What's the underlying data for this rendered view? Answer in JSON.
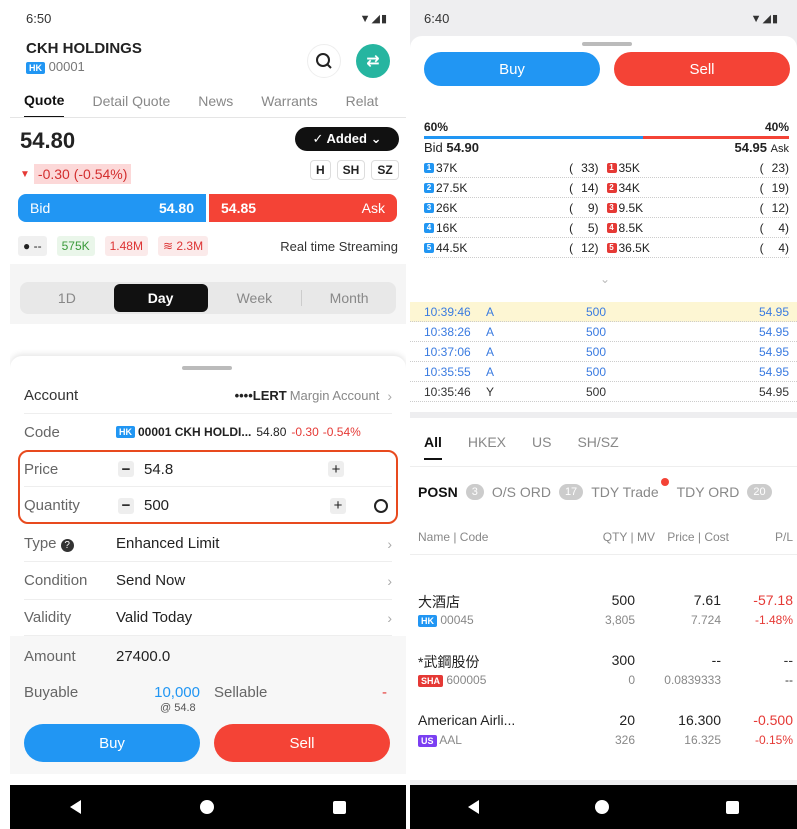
{
  "left": {
    "time": "6:50",
    "stock_name": "CKH HOLDINGS",
    "market_tag": "HK",
    "stock_code": "00001",
    "tabs": [
      "Quote",
      "Detail Quote",
      "News",
      "Warrants",
      "Relat"
    ],
    "price": "54.80",
    "added_label": "✓ Added ⌄",
    "change": "-0.30 (-0.54%)",
    "exchanges": [
      "H",
      "SH",
      "SZ"
    ],
    "bid_label": "Bid",
    "bid_price": "54.80",
    "ask_price": "54.85",
    "ask_label": "Ask",
    "stats": {
      "dash": "--",
      "vol": "575K",
      "turnover": "1.48M",
      "mcap": "2.3M"
    },
    "streaming": "Real time Streaming",
    "periods": [
      "1D",
      "Day",
      "Week",
      "Month"
    ],
    "order": {
      "account_label": "Account",
      "account_value": "••••LERT",
      "account_type": "Margin Account",
      "code_label": "Code",
      "code_tag": "HK",
      "code_value": "00001 CKH HOLDI...",
      "code_price": "54.80",
      "code_change": "-0.30",
      "code_pct": "-0.54%",
      "price_label": "Price",
      "price_value": "54.8",
      "qty_label": "Quantity",
      "qty_value": "500",
      "type_label": "Type",
      "type_value": "Enhanced Limit",
      "cond_label": "Condition",
      "cond_value": "Send Now",
      "validity_label": "Validity",
      "validity_value": "Valid Today",
      "amount_label": "Amount",
      "amount_value": "27400.0",
      "buyable_label": "Buyable",
      "buyable_value": "10,000",
      "buyable_sub": "@ 54.8",
      "sellable_label": "Sellable",
      "sellable_value": "-",
      "buy": "Buy",
      "sell": "Sell"
    }
  },
  "right": {
    "time": "6:40",
    "buy": "Buy",
    "sell": "Sell",
    "bid_pct": "60%",
    "ask_pct": "40%",
    "bid_label": "Bid",
    "bid_price": "54.90",
    "ask_price": "54.95",
    "ask_label": "Ask",
    "book": [
      {
        "lvl": "1",
        "bid": "37K",
        "bidn": "33",
        "ask": "35K",
        "askn": "23"
      },
      {
        "lvl": "2",
        "bid": "27.5K",
        "bidn": "14",
        "ask": "34K",
        "askn": "19"
      },
      {
        "lvl": "3",
        "bid": "26K",
        "bidn": "9",
        "ask": "9.5K",
        "askn": "12"
      },
      {
        "lvl": "4",
        "bid": "16K",
        "bidn": "5",
        "ask": "8.5K",
        "askn": "4"
      },
      {
        "lvl": "5",
        "bid": "44.5K",
        "bidn": "12",
        "ask": "36.5K",
        "askn": "4"
      }
    ],
    "trades": [
      {
        "time": "10:39:46",
        "side": "A",
        "qty": "500",
        "price": "54.95"
      },
      {
        "time": "10:38:26",
        "side": "A",
        "qty": "500",
        "price": "54.95"
      },
      {
        "time": "10:37:06",
        "side": "A",
        "qty": "500",
        "price": "54.95"
      },
      {
        "time": "10:35:55",
        "side": "A",
        "qty": "500",
        "price": "54.95"
      },
      {
        "time": "10:35:46",
        "side": "Y",
        "qty": "500",
        "price": "54.95"
      }
    ],
    "markets": [
      "All",
      "HKEX",
      "US",
      "SH/SZ"
    ],
    "subtabs": {
      "posn": "POSN",
      "posn_n": "3",
      "os": "O/S ORD",
      "os_n": "17",
      "tdy": "TDY Trade",
      "tdyord": "TDY ORD",
      "tdyord_n": "20"
    },
    "headers": {
      "name": "Name | Code",
      "qty": "QTY | MV",
      "price": "Price | Cost",
      "pl": "P/L"
    },
    "positions": [
      {
        "name": "大酒店",
        "tag": "HK",
        "code": "00045",
        "qty": "500",
        "mv": "3,805",
        "price": "7.61",
        "cost": "7.724",
        "pl": "-57.18",
        "plpct": "-1.48%"
      },
      {
        "name": "*武鋼股份",
        "tag": "SHA",
        "code": "600005",
        "qty": "300",
        "mv": "0",
        "price": "--",
        "cost": "0.0839333",
        "pl": "--",
        "plpct": "--"
      },
      {
        "name": "American Airli...",
        "tag": "US",
        "code": "AAL",
        "qty": "20",
        "mv": "326",
        "price": "16.300",
        "cost": "16.325",
        "pl": "-0.500",
        "plpct": "-0.15%"
      }
    ]
  },
  "colors": {
    "blue": "#2196f3",
    "red": "#f44336",
    "teal": "#26b5a0"
  }
}
